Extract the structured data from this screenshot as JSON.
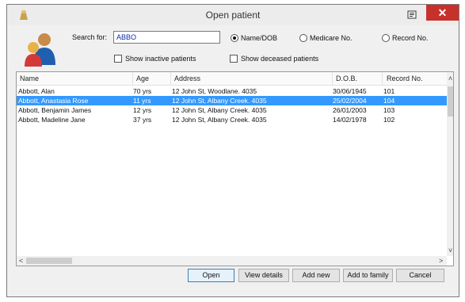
{
  "window": {
    "title": "Open patient",
    "close_glyph": "✕"
  },
  "search": {
    "label": "Search for:",
    "value": "ABBO",
    "modes": [
      {
        "label": "Name/DOB",
        "checked": true
      },
      {
        "label": "Medicare No.",
        "checked": false
      },
      {
        "label": "Record No.",
        "checked": false
      }
    ],
    "show_inactive_label": "Show inactive patients",
    "show_deceased_label": "Show deceased patients"
  },
  "table": {
    "columns": [
      "Name",
      "Age",
      "Address",
      "D.O.B.",
      "Record No."
    ],
    "rows": [
      {
        "name": "Abbott, Alan",
        "age": "70 yrs",
        "address": "12 John St, Woodlane. 4035",
        "dob": "30/06/1945",
        "record": "101",
        "selected": false
      },
      {
        "name": "Abbott, Anastasia Rose",
        "age": "11 yrs",
        "address": "12 John St, Albany Creek. 4035",
        "dob": "25/02/2004",
        "record": "104",
        "selected": true
      },
      {
        "name": "Abbott, Benjamin James",
        "age": "12 yrs",
        "address": "12 John St, Albany Creek. 4035",
        "dob": "26/01/2003",
        "record": "103",
        "selected": false
      },
      {
        "name": "Abbott, Madeline Jane",
        "age": "37 yrs",
        "address": "12 John St, Albany Creek. 4035",
        "dob": "14/02/1978",
        "record": "102",
        "selected": false
      }
    ]
  },
  "buttons": {
    "open": "Open",
    "view_details": "View details",
    "add_new": "Add new",
    "add_to_family": "Add to family",
    "cancel": "Cancel"
  },
  "scroll": {
    "up": "˄",
    "down": "˅",
    "left": "<",
    "right": ">"
  },
  "colors": {
    "selection": "#3399ff",
    "close": "#c7312b",
    "search_text": "#0a2ea8"
  },
  "icons": [
    "app-icon",
    "help-icon",
    "patients-avatar-icon",
    "close-icon"
  ]
}
